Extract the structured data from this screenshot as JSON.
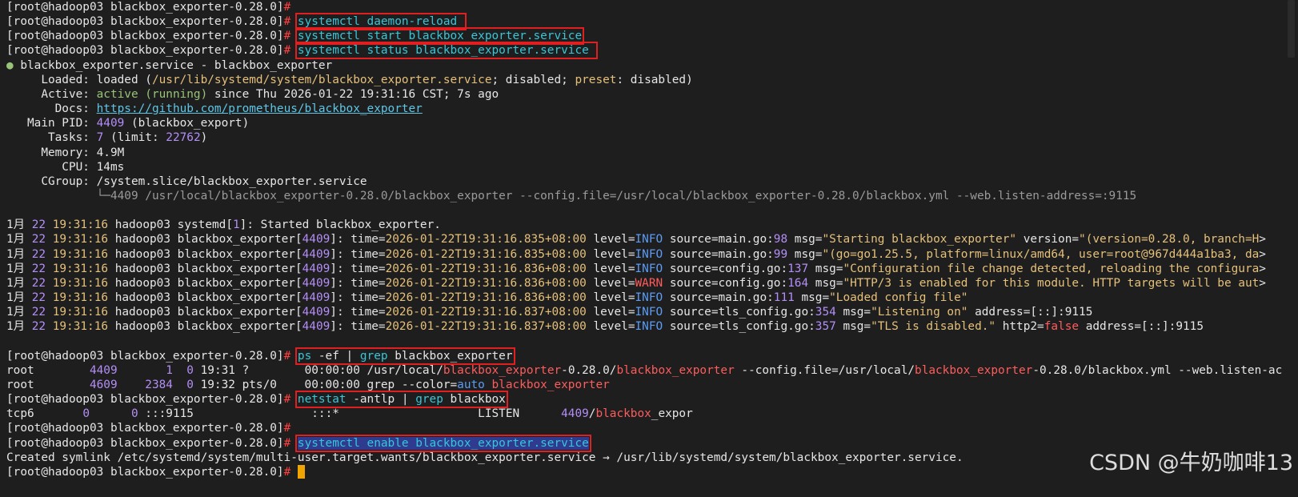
{
  "colors": {
    "background": "#1e1e1e",
    "command": "#38c6d9",
    "highlight_box": "#e02020",
    "cursor": "#f0a500"
  },
  "lines": [
    {
      "spans": [
        {
          "t": "[root@hadoop03 blackbox_exporter-0.28.0]",
          "c": "prompt"
        },
        {
          "t": "#",
          "c": "hash"
        }
      ]
    },
    {
      "spans": [
        {
          "t": "[root@hadoop03 blackbox_exporter-0.28.0]",
          "c": "prompt"
        },
        {
          "t": "#",
          "c": "hash"
        },
        {
          "t": " ",
          "c": "def"
        },
        {
          "t": "systemctl daemon-reload ",
          "c": "cmdbox",
          "box": true
        }
      ]
    },
    {
      "spans": [
        {
          "t": "[root@hadoop03 blackbox_exporter-0.28.0]",
          "c": "prompt"
        },
        {
          "t": "#",
          "c": "hash"
        },
        {
          "t": " ",
          "c": "def"
        },
        {
          "t": "systemctl start blackbox_exporter.service",
          "c": "cmdbox",
          "box": true
        }
      ]
    },
    {
      "spans": [
        {
          "t": "[root@hadoop03 blackbox_exporter-0.28.0]",
          "c": "prompt"
        },
        {
          "t": "#",
          "c": "hash"
        },
        {
          "t": " ",
          "c": "def"
        },
        {
          "t": "systemctl status blackbox_exporter.service ",
          "c": "cmdbox",
          "box": true
        }
      ]
    },
    {
      "spans": [
        {
          "t": "●",
          "c": "dot"
        },
        {
          "t": " blackbox_exporter.service - blackbox_exporter",
          "c": "def"
        }
      ]
    },
    {
      "spans": [
        {
          "t": "     Loaded: loaded (",
          "c": "def"
        },
        {
          "t": "/usr/lib/systemd/system/blackbox_exporter.service",
          "c": "yel"
        },
        {
          "t": "; disabled; ",
          "c": "def"
        },
        {
          "t": "preset",
          "c": "yel"
        },
        {
          "t": ": disabled)",
          "c": "def"
        }
      ]
    },
    {
      "spans": [
        {
          "t": "     Active: ",
          "c": "def"
        },
        {
          "t": "active (running)",
          "c": "grn"
        },
        {
          "t": " since Thu 2026-01-22 19:31:16 CST; 7s ago",
          "c": "def"
        }
      ]
    },
    {
      "spans": [
        {
          "t": "       Docs: ",
          "c": "def"
        },
        {
          "t": "https://github.com/prometheus/blackbox_exporter",
          "c": "link"
        }
      ]
    },
    {
      "spans": [
        {
          "t": "   Main PID: ",
          "c": "def"
        },
        {
          "t": "4409",
          "c": "pur"
        },
        {
          "t": " (blackbox_export)",
          "c": "def"
        }
      ]
    },
    {
      "spans": [
        {
          "t": "      Tasks: ",
          "c": "def"
        },
        {
          "t": "7",
          "c": "pur"
        },
        {
          "t": " (limit: ",
          "c": "def"
        },
        {
          "t": "22762",
          "c": "pur"
        },
        {
          "t": ")",
          "c": "def"
        }
      ]
    },
    {
      "spans": [
        {
          "t": "     Memory: 4.9M",
          "c": "def"
        }
      ]
    },
    {
      "spans": [
        {
          "t": "        CPU: 14ms",
          "c": "def"
        }
      ]
    },
    {
      "spans": [
        {
          "t": "     CGroup: /system.slice/blackbox_exporter.service",
          "c": "def"
        }
      ]
    },
    {
      "spans": [
        {
          "t": "             └─4409 /usr/local/blackbox_exporter-0.28.0/blackbox_exporter --config.file=/usr/local/blackbox_exporter-0.28.0/blackbox.yml --web.listen-address=:9115",
          "c": "gry"
        }
      ]
    },
    {
      "spans": [
        {
          "t": " ",
          "c": "def"
        }
      ]
    },
    {
      "spans": [
        {
          "t": "1月 ",
          "c": "def"
        },
        {
          "t": "22",
          "c": "pur"
        },
        {
          "t": " 19:31:16",
          "c": "yel"
        },
        {
          "t": " hadoop03 systemd[",
          "c": "def"
        },
        {
          "t": "1",
          "c": "pur"
        },
        {
          "t": "]: Started blackbox_exporter.",
          "c": "def"
        }
      ]
    },
    {
      "spans": [
        {
          "t": "1月 ",
          "c": "def"
        },
        {
          "t": "22",
          "c": "pur"
        },
        {
          "t": " 19:31:16",
          "c": "yel"
        },
        {
          "t": " hadoop03 blackbox_exporter[",
          "c": "def"
        },
        {
          "t": "4409",
          "c": "pur"
        },
        {
          "t": "]: time=",
          "c": "def"
        },
        {
          "t": "2026-01-22T19:31:16.835+08:00",
          "c": "yel"
        },
        {
          "t": " level=",
          "c": "def"
        },
        {
          "t": "INFO",
          "c": "blu"
        },
        {
          "t": " source=main.go:",
          "c": "def"
        },
        {
          "t": "98",
          "c": "pur"
        },
        {
          "t": " msg=",
          "c": "def"
        },
        {
          "t": "\"Starting blackbox_exporter\"",
          "c": "yel"
        },
        {
          "t": " version=",
          "c": "def"
        },
        {
          "t": "\"(version=0.28.0, branch=H",
          "c": "yel"
        },
        {
          "t": ">",
          "c": "def"
        }
      ]
    },
    {
      "spans": [
        {
          "t": "1月 ",
          "c": "def"
        },
        {
          "t": "22",
          "c": "pur"
        },
        {
          "t": " 19:31:16",
          "c": "yel"
        },
        {
          "t": " hadoop03 blackbox_exporter[",
          "c": "def"
        },
        {
          "t": "4409",
          "c": "pur"
        },
        {
          "t": "]: time=",
          "c": "def"
        },
        {
          "t": "2026-01-22T19:31:16.835+08:00",
          "c": "yel"
        },
        {
          "t": " level=",
          "c": "def"
        },
        {
          "t": "INFO",
          "c": "blu"
        },
        {
          "t": " source=main.go:",
          "c": "def"
        },
        {
          "t": "99",
          "c": "pur"
        },
        {
          "t": " msg=",
          "c": "def"
        },
        {
          "t": "\"(go=go1.25.5, platform=linux/amd64, user=root@967d444a1ba3, da",
          "c": "yel"
        },
        {
          "t": ">",
          "c": "def"
        }
      ]
    },
    {
      "spans": [
        {
          "t": "1月 ",
          "c": "def"
        },
        {
          "t": "22",
          "c": "pur"
        },
        {
          "t": " 19:31:16",
          "c": "yel"
        },
        {
          "t": " hadoop03 blackbox_exporter[",
          "c": "def"
        },
        {
          "t": "4409",
          "c": "pur"
        },
        {
          "t": "]: time=",
          "c": "def"
        },
        {
          "t": "2026-01-22T19:31:16.836+08:00",
          "c": "yel"
        },
        {
          "t": " level=",
          "c": "def"
        },
        {
          "t": "INFO",
          "c": "blu"
        },
        {
          "t": " source=config.go:",
          "c": "def"
        },
        {
          "t": "137",
          "c": "pur"
        },
        {
          "t": " msg=",
          "c": "def"
        },
        {
          "t": "\"Configuration file change detected, reloading the configura",
          "c": "yel"
        },
        {
          "t": ">",
          "c": "def"
        }
      ]
    },
    {
      "spans": [
        {
          "t": "1月 ",
          "c": "def"
        },
        {
          "t": "22",
          "c": "pur"
        },
        {
          "t": " 19:31:16",
          "c": "yel"
        },
        {
          "t": " hadoop03 blackbox_exporter[",
          "c": "def"
        },
        {
          "t": "4409",
          "c": "pur"
        },
        {
          "t": "]: time=",
          "c": "def"
        },
        {
          "t": "2026-01-22T19:31:16.836+08:00",
          "c": "yel"
        },
        {
          "t": " level=",
          "c": "def"
        },
        {
          "t": "WARN",
          "c": "red"
        },
        {
          "t": " source=config.go:",
          "c": "def"
        },
        {
          "t": "164",
          "c": "pur"
        },
        {
          "t": " msg=",
          "c": "def"
        },
        {
          "t": "\"HTTP/3 is enabled for this module. HTTP targets will be aut",
          "c": "yel"
        },
        {
          "t": ">",
          "c": "def"
        }
      ]
    },
    {
      "spans": [
        {
          "t": "1月 ",
          "c": "def"
        },
        {
          "t": "22",
          "c": "pur"
        },
        {
          "t": " 19:31:16",
          "c": "yel"
        },
        {
          "t": " hadoop03 blackbox_exporter[",
          "c": "def"
        },
        {
          "t": "4409",
          "c": "pur"
        },
        {
          "t": "]: time=",
          "c": "def"
        },
        {
          "t": "2026-01-22T19:31:16.836+08:00",
          "c": "yel"
        },
        {
          "t": " level=",
          "c": "def"
        },
        {
          "t": "INFO",
          "c": "blu"
        },
        {
          "t": " source=main.go:",
          "c": "def"
        },
        {
          "t": "111",
          "c": "pur"
        },
        {
          "t": " msg=",
          "c": "def"
        },
        {
          "t": "\"Loaded config file\"",
          "c": "yel"
        }
      ]
    },
    {
      "spans": [
        {
          "t": "1月 ",
          "c": "def"
        },
        {
          "t": "22",
          "c": "pur"
        },
        {
          "t": " 19:31:16",
          "c": "yel"
        },
        {
          "t": " hadoop03 blackbox_exporter[",
          "c": "def"
        },
        {
          "t": "4409",
          "c": "pur"
        },
        {
          "t": "]: time=",
          "c": "def"
        },
        {
          "t": "2026-01-22T19:31:16.837+08:00",
          "c": "yel"
        },
        {
          "t": " level=",
          "c": "def"
        },
        {
          "t": "INFO",
          "c": "blu"
        },
        {
          "t": " source=tls_config.go:",
          "c": "def"
        },
        {
          "t": "354",
          "c": "pur"
        },
        {
          "t": " msg=",
          "c": "def"
        },
        {
          "t": "\"Listening on\"",
          "c": "yel"
        },
        {
          "t": " address=[::]:9115",
          "c": "def"
        }
      ]
    },
    {
      "spans": [
        {
          "t": "1月 ",
          "c": "def"
        },
        {
          "t": "22",
          "c": "pur"
        },
        {
          "t": " 19:31:16",
          "c": "yel"
        },
        {
          "t": " hadoop03 blackbox_exporter[",
          "c": "def"
        },
        {
          "t": "4409",
          "c": "pur"
        },
        {
          "t": "]: time=",
          "c": "def"
        },
        {
          "t": "2026-01-22T19:31:16.837+08:00",
          "c": "yel"
        },
        {
          "t": " level=",
          "c": "def"
        },
        {
          "t": "INFO",
          "c": "blu"
        },
        {
          "t": " source=tls_config.go:",
          "c": "def"
        },
        {
          "t": "357",
          "c": "pur"
        },
        {
          "t": " msg=",
          "c": "def"
        },
        {
          "t": "\"TLS is disabled.\"",
          "c": "yel"
        },
        {
          "t": " http2=",
          "c": "def"
        },
        {
          "t": "false",
          "c": "red"
        },
        {
          "t": " address=[::]:9115",
          "c": "def"
        }
      ]
    },
    {
      "spans": [
        {
          "t": " ",
          "c": "def"
        }
      ]
    },
    {
      "spans": [
        {
          "t": "[root@hadoop03 blackbox_exporter-0.28.0]",
          "c": "prompt"
        },
        {
          "t": "#",
          "c": "hash"
        },
        {
          "t": " ",
          "c": "def"
        },
        {
          "t": "ps -ef | grep blackbox_exporter",
          "c": "mixbox",
          "box": true,
          "parts": [
            {
              "t": "ps",
              "c": "cmd"
            },
            {
              "t": " -ef | ",
              "c": "def"
            },
            {
              "t": "grep",
              "c": "cmd"
            },
            {
              "t": " blackbox_exporter",
              "c": "def"
            }
          ]
        }
      ]
    },
    {
      "spans": [
        {
          "t": "root        ",
          "c": "def"
        },
        {
          "t": "4409",
          "c": "pur"
        },
        {
          "t": "       ",
          "c": "def"
        },
        {
          "t": "1",
          "c": "pur"
        },
        {
          "t": "  ",
          "c": "def"
        },
        {
          "t": "0",
          "c": "pur"
        },
        {
          "t": " 19:31 ?        00:00:00 /usr/local/",
          "c": "def"
        },
        {
          "t": "blackbox_exporter",
          "c": "red"
        },
        {
          "t": "-0.28.0/",
          "c": "def"
        },
        {
          "t": "blackbox_exporter",
          "c": "red"
        },
        {
          "t": " --config.file=/usr/local/",
          "c": "def"
        },
        {
          "t": "blackbox_exporter",
          "c": "red"
        },
        {
          "t": "-0.28.0/blackbox.yml --web.listen-ac",
          "c": "def"
        }
      ]
    },
    {
      "spans": [
        {
          "t": "root        ",
          "c": "def"
        },
        {
          "t": "4609",
          "c": "pur"
        },
        {
          "t": "    ",
          "c": "def"
        },
        {
          "t": "2384",
          "c": "pur"
        },
        {
          "t": "  ",
          "c": "def"
        },
        {
          "t": "0",
          "c": "pur"
        },
        {
          "t": " 19:32 pts/0    00:00:00 grep --color=",
          "c": "def"
        },
        {
          "t": "auto",
          "c": "blu"
        },
        {
          "t": " ",
          "c": "def"
        },
        {
          "t": "blackbox_exporter",
          "c": "red"
        }
      ]
    },
    {
      "spans": [
        {
          "t": "[root@hadoop03 blackbox_exporter-0.28.0]",
          "c": "prompt"
        },
        {
          "t": "#",
          "c": "hash"
        },
        {
          "t": " ",
          "c": "def"
        },
        {
          "t": "netstat -antlp | grep blackbox",
          "c": "mixbox",
          "box": true,
          "parts": [
            {
              "t": "netstat",
              "c": "cmd"
            },
            {
              "t": " -antlp | ",
              "c": "def"
            },
            {
              "t": "grep",
              "c": "cmd"
            },
            {
              "t": " blackbox",
              "c": "def"
            }
          ]
        }
      ]
    },
    {
      "spans": [
        {
          "t": "tcp6       ",
          "c": "def"
        },
        {
          "t": "0",
          "c": "pur"
        },
        {
          "t": "      ",
          "c": "def"
        },
        {
          "t": "0",
          "c": "pur"
        },
        {
          "t": " :::9115                 :::*                    LISTEN      ",
          "c": "def"
        },
        {
          "t": "4409",
          "c": "pur"
        },
        {
          "t": "/",
          "c": "def"
        },
        {
          "t": "blackbox",
          "c": "red"
        },
        {
          "t": "_expor",
          "c": "def"
        }
      ]
    },
    {
      "spans": [
        {
          "t": "[root@hadoop03 blackbox_exporter-0.28.0]",
          "c": "prompt"
        },
        {
          "t": "#",
          "c": "hash"
        }
      ]
    },
    {
      "spans": [
        {
          "t": "[root@hadoop03 blackbox_exporter-0.28.0]",
          "c": "prompt"
        },
        {
          "t": "#",
          "c": "hash"
        },
        {
          "t": " ",
          "c": "def"
        },
        {
          "t": "systemctl enable blackbox_exporter.service",
          "c": "hlbox",
          "box": true
        }
      ]
    },
    {
      "spans": [
        {
          "t": "Created symlink /etc/systemd/system/multi-user.target.wants/blackbox_exporter.service → /usr/lib/systemd/system/blackbox_exporter.service.",
          "c": "def"
        }
      ]
    },
    {
      "spans": [
        {
          "t": "[root@hadoop03 blackbox_exporter-0.28.0]",
          "c": "prompt"
        },
        {
          "t": "#",
          "c": "hash"
        },
        {
          "t": " ",
          "c": "def"
        }
      ],
      "cursor": true
    }
  ],
  "watermark": "CSDN @牛奶咖啡13"
}
